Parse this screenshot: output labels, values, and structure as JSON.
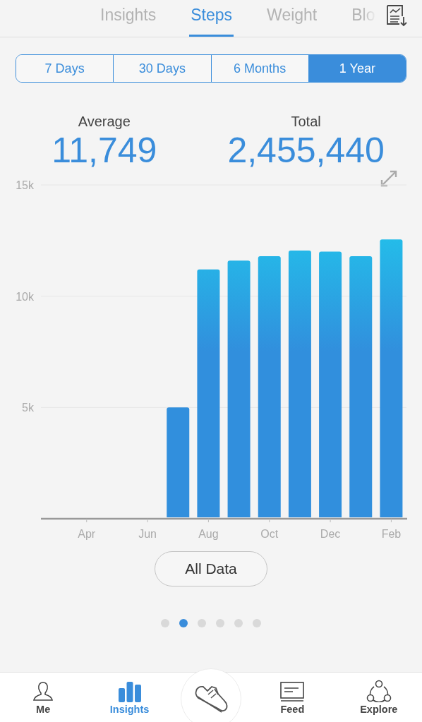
{
  "top_tabs": [
    {
      "label": "Insights",
      "selected": false
    },
    {
      "label": "Steps",
      "selected": true
    },
    {
      "label": "Weight",
      "selected": false
    },
    {
      "label": "Blo",
      "selected": false
    }
  ],
  "ranges": [
    {
      "label": "7 Days",
      "selected": false
    },
    {
      "label": "30 Days",
      "selected": false
    },
    {
      "label": "6 Months",
      "selected": false
    },
    {
      "label": "1 Year",
      "selected": true
    }
  ],
  "stats": [
    {
      "label": "Average",
      "value": "11,749"
    },
    {
      "label": "Total",
      "value": "2,455,440"
    }
  ],
  "chart_data": {
    "type": "bar",
    "categories": [
      null,
      "Apr",
      null,
      "Jun",
      null,
      "Aug",
      null,
      "Oct",
      null,
      "Dec",
      null,
      "Feb"
    ],
    "values": [
      null,
      null,
      null,
      null,
      5000,
      11200,
      11600,
      11800,
      12050,
      12000,
      11800,
      12550
    ],
    "ylim": [
      0,
      15000
    ],
    "yticks": [
      {
        "value": 5000,
        "label": "5k"
      },
      {
        "value": 10000,
        "label": "10k"
      },
      {
        "value": 15000,
        "label": "15k"
      }
    ]
  },
  "all_data_button": "All Data",
  "pages": [
    {
      "selected": false
    },
    {
      "selected": true
    },
    {
      "selected": false
    },
    {
      "selected": false
    },
    {
      "selected": false
    },
    {
      "selected": false
    }
  ],
  "nav": [
    {
      "kind": "tab",
      "label": "Me",
      "selected": false
    },
    {
      "kind": "tab",
      "label": "Insights",
      "selected": true
    },
    {
      "kind": "action"
    },
    {
      "kind": "tab",
      "label": "Feed",
      "selected": false
    },
    {
      "kind": "tab",
      "label": "Explore",
      "selected": false
    }
  ]
}
